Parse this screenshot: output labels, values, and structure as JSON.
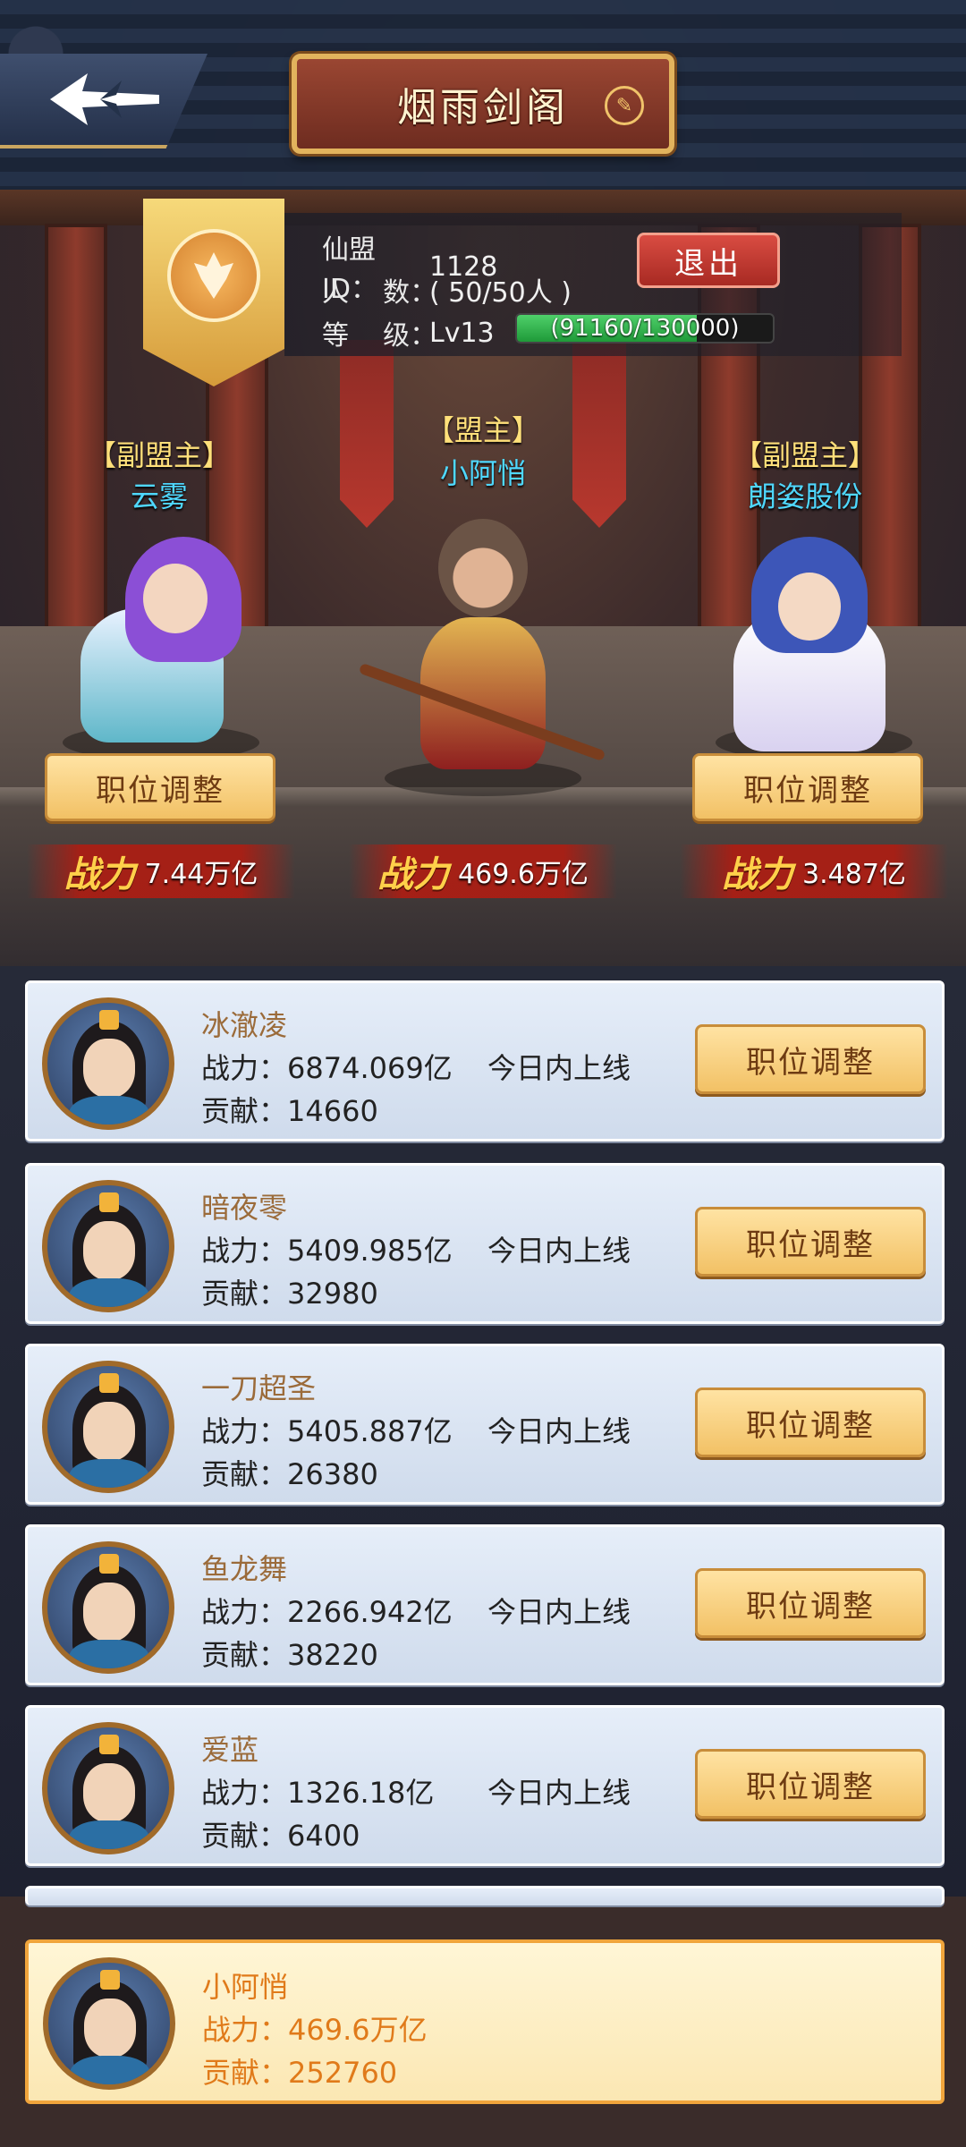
{
  "header": {
    "title": "烟雨剑阁",
    "back_icon": "back-arrow-icon",
    "edit_icon": "edit-pen-icon"
  },
  "guild": {
    "id_label": "仙盟ID：",
    "id_value": "1128",
    "members_label": "人    数：",
    "members_value": "( 50/50人 )",
    "level_label": "等    级：",
    "level_value": "Lv13",
    "exp_text": "(91160/130000)",
    "exp_fraction": 0.7012,
    "quit_label": "退出",
    "emblem_icon": "guild-emblem-icon"
  },
  "leaders": [
    {
      "title": "【副盟主】",
      "name": "云雾",
      "power_label": "战力",
      "power": "7.44万亿",
      "button": "职位调整"
    },
    {
      "title": "【盟主】",
      "name": "小阿悄",
      "power_label": "战力",
      "power": "469.6万亿",
      "button": ""
    },
    {
      "title": "【副盟主】",
      "name": "朗姿股份",
      "power_label": "战力",
      "power": "3.487亿",
      "button": "职位调整"
    }
  ],
  "members": [
    {
      "name": "冰澈凌",
      "power": "战力：6874.069亿",
      "status": "今日内上线",
      "contrib": "贡献：14660",
      "button": "职位调整"
    },
    {
      "name": "暗夜零",
      "power": "战力：5409.985亿",
      "status": "今日内上线",
      "contrib": "贡献：32980",
      "button": "职位调整"
    },
    {
      "name": "一刀超圣",
      "power": "战力：5405.887亿",
      "status": "今日内上线",
      "contrib": "贡献：26380",
      "button": "职位调整"
    },
    {
      "name": "鱼龙舞",
      "power": "战力：2266.942亿",
      "status": "今日内上线",
      "contrib": "贡献：38220",
      "button": "职位调整"
    },
    {
      "name": "爱蓝",
      "power": "战力：1326.18亿",
      "status": "今日内上线",
      "contrib": "贡献：6400",
      "button": "职位调整"
    }
  ],
  "self": {
    "name": "小阿悄",
    "power": "战力：469.6万亿",
    "contrib": "贡献：252760"
  }
}
